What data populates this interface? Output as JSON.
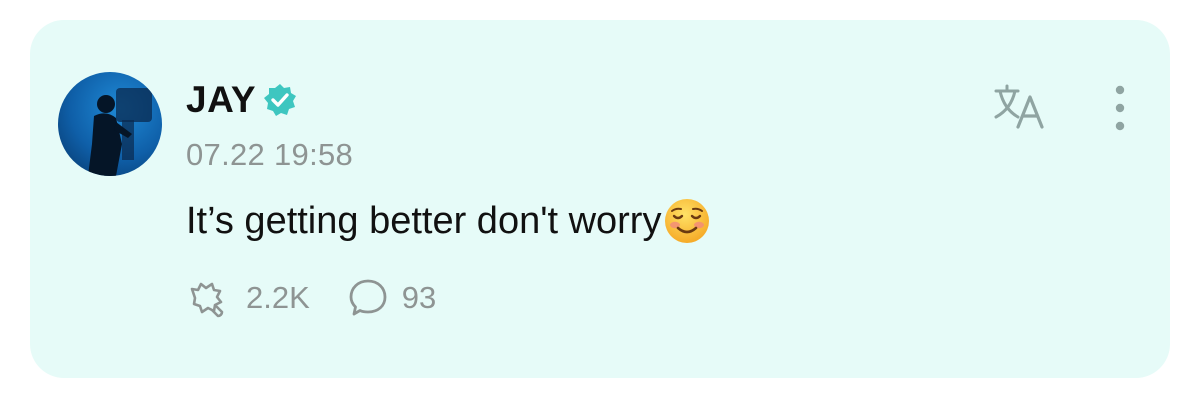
{
  "post": {
    "author": {
      "name": "JAY",
      "verified": true,
      "verified_badge_icon": "verified-badge-icon",
      "avatar_icon": "avatar-silhouette"
    },
    "timestamp": "07.22 19:58",
    "text": "It’s getting better don't worry",
    "text_emoji": "smiling-face-icon",
    "actions": {
      "likes": {
        "icon": "like-icon",
        "count": "2.2K"
      },
      "comments": {
        "icon": "comment-bubble-icon",
        "count": "93"
      }
    },
    "header_actions": {
      "translate_icon": "translate-icon",
      "more_icon": "more-vertical-icon"
    }
  },
  "colors": {
    "card_background": "#e6fbf8",
    "verified_accent": "#3ec6c0",
    "icon_muted": "#8fa4a2",
    "text_primary": "#111111",
    "text_secondary": "#8e9493"
  }
}
